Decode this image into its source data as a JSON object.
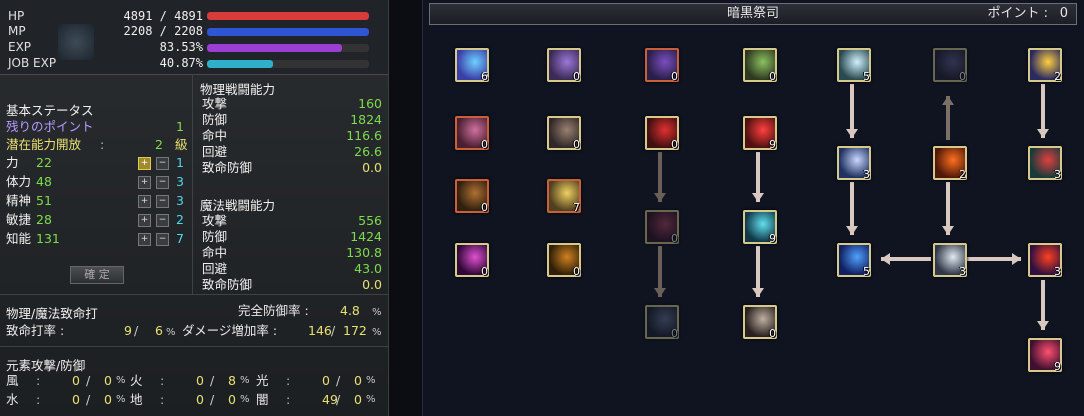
{
  "top_stats": [
    {
      "label": "HP",
      "value": "4891 / 4891",
      "fill": 1.0,
      "color": "#d93b3b"
    },
    {
      "label": "MP",
      "value": "2208 / 2208",
      "fill": 1.0,
      "color": "#2f55d4"
    },
    {
      "label": "EXP",
      "value": "83.53%",
      "fill": 0.8353,
      "color": "#9a3fd1"
    },
    {
      "label": "JOB EXP",
      "value": "40.87%",
      "fill": 0.4087,
      "color": "#2fb0c9"
    }
  ],
  "basic": {
    "title": "基本ステータス",
    "remaining_label": "残りのポイント",
    "remaining_value": "1",
    "potential_label": "潜在能力開放",
    "potential_sep": ":",
    "potential_value": "2",
    "potential_unit": "級",
    "stats": [
      {
        "name": "力",
        "value": "22",
        "plus": "+",
        "minus": "−",
        "bonus": "1"
      },
      {
        "name": "体力",
        "value": "48",
        "plus": "+",
        "minus": "−",
        "bonus": "3"
      },
      {
        "name": "精神",
        "value": "51",
        "plus": "+",
        "minus": "−",
        "bonus": "3"
      },
      {
        "name": "敏捷",
        "value": "28",
        "plus": "+",
        "minus": "−",
        "bonus": "2"
      },
      {
        "name": "知能",
        "value": "131",
        "plus": "+",
        "minus": "−",
        "bonus": "7"
      }
    ],
    "confirm_label": "確 定"
  },
  "physical": {
    "title": "物理戦闘能力",
    "rows": [
      {
        "name": "攻撃",
        "value": "160"
      },
      {
        "name": "防御",
        "value": "1824"
      },
      {
        "name": "命中",
        "value": "116.6"
      },
      {
        "name": "回避",
        "value": "26.6"
      },
      {
        "name": "致命防御",
        "value": "0.0"
      }
    ]
  },
  "magic": {
    "title": "魔法戦闘能力",
    "rows": [
      {
        "name": "攻撃",
        "value": "556"
      },
      {
        "name": "防御",
        "value": "1424"
      },
      {
        "name": "命中",
        "value": "130.8"
      },
      {
        "name": "回避",
        "value": "43.0"
      },
      {
        "name": "致命防御",
        "value": "0.0"
      }
    ]
  },
  "critical": {
    "title": "物理/魔法致命打",
    "perfect_def_label": "完全防御率 :",
    "perfect_def_value": "4.8",
    "crit_rate_label": "致命打率 :",
    "crit_rate_a": "9",
    "crit_rate_b": "6",
    "dmg_label": "ダメージ増加率 :",
    "dmg_a": "146",
    "dmg_b": "172",
    "pct": "%",
    "slash": "/"
  },
  "element": {
    "title": "元素攻撃/防御",
    "rows": [
      [
        {
          "name": "風",
          "a": "0",
          "b": "0"
        },
        {
          "name": "火",
          "a": "0",
          "b": "8"
        },
        {
          "name": "光",
          "a": "0",
          "b": "0"
        }
      ],
      [
        {
          "name": "水",
          "a": "0",
          "b": "0"
        },
        {
          "name": "地",
          "a": "0",
          "b": "0"
        },
        {
          "name": "闇",
          "a": "49",
          "b": "0"
        }
      ]
    ],
    "colon": ":",
    "slash": "/",
    "pct": "%"
  },
  "skill_tree": {
    "title": "暗黒祭司",
    "points_label": "ポイント :",
    "points_value": "0",
    "skills": [
      {
        "level": "6",
        "colors": [
          "#3a3fa8",
          "#6fd0ff"
        ],
        "border": "gold"
      },
      {
        "level": "0",
        "colors": [
          "#3b2a55",
          "#9a78d8"
        ],
        "border": "gold"
      },
      {
        "level": "0",
        "colors": [
          "#2a1f4a",
          "#7a4fc0"
        ],
        "border": "red"
      },
      {
        "level": "0",
        "colors": [
          "#2e3a20",
          "#8cc060"
        ],
        "border": "gold"
      },
      {
        "level": "5",
        "colors": [
          "#2a4a50",
          "#d0f0ff"
        ],
        "border": "gold"
      },
      {
        "level": "0",
        "colors": [
          "#202030",
          "#5a5a8a"
        ],
        "border": "dim"
      },
      {
        "level": "2",
        "colors": [
          "#2a2a60",
          "#ffd040"
        ],
        "border": "gold"
      },
      {
        "level": "0",
        "colors": [
          "#4a2030",
          "#d070a0"
        ],
        "border": "red"
      },
      {
        "level": "0",
        "colors": [
          "#302828",
          "#9a8070"
        ],
        "border": "gold"
      },
      {
        "level": "0",
        "colors": [
          "#401010",
          "#e03030"
        ],
        "border": "gold"
      },
      {
        "level": "9",
        "colors": [
          "#501010",
          "#ff4040"
        ],
        "border": "gold"
      },
      {
        "level": "3",
        "colors": [
          "#203060",
          "#c8d8ff"
        ],
        "border": "gold"
      },
      {
        "level": "2",
        "colors": [
          "#501808",
          "#ff7020"
        ],
        "border": "gold"
      },
      {
        "level": "3",
        "colors": [
          "#1a3a3a",
          "#e04040"
        ],
        "border": "gold"
      },
      {
        "level": "0",
        "colors": [
          "#302010",
          "#b07030"
        ],
        "border": "red"
      },
      {
        "level": "7",
        "colors": [
          "#504020",
          "#f0d060"
        ],
        "border": "red"
      },
      {
        "level": "0",
        "colors": [
          "#301020",
          "#a04060"
        ],
        "border": "dim"
      },
      {
        "level": "9",
        "colors": [
          "#103848",
          "#60e0f0"
        ],
        "border": "gold"
      },
      {
        "level": "5",
        "colors": [
          "#102060",
          "#50a0ff"
        ],
        "border": "gold"
      },
      {
        "level": "3",
        "colors": [
          "#303848",
          "#e0e8f0"
        ],
        "border": "gold"
      },
      {
        "level": "3",
        "colors": [
          "#301040",
          "#ff4020"
        ],
        "border": "gold"
      },
      {
        "level": "0",
        "colors": [
          "#300838",
          "#e050d0"
        ],
        "border": "gold"
      },
      {
        "level": "0",
        "colors": [
          "#302008",
          "#d08020"
        ],
        "border": "gold"
      },
      {
        "level": "0",
        "colors": [
          "#1a2030",
          "#607090"
        ],
        "border": "dim"
      },
      {
        "level": "0",
        "colors": [
          "#282020",
          "#c0b0a0"
        ],
        "border": "gold"
      },
      {
        "level": "9",
        "colors": [
          "#401030",
          "#ff5070"
        ],
        "border": "gold"
      }
    ]
  }
}
